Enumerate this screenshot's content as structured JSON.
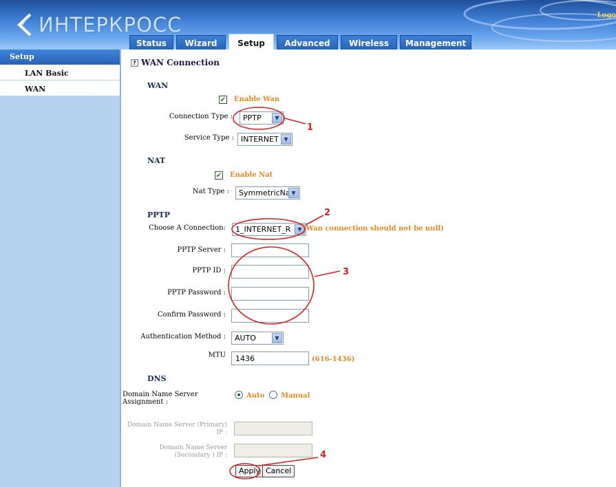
{
  "header": {
    "logo_text": "ИНТЕРКРОСС",
    "logout_label": "Logo"
  },
  "tabs": [
    {
      "label": "Status"
    },
    {
      "label": "Wizard"
    },
    {
      "label": "Setup",
      "active": true
    },
    {
      "label": "Advanced"
    },
    {
      "label": "Wireless"
    },
    {
      "label": "Management"
    }
  ],
  "sidebar": {
    "heading": "Setup",
    "items": [
      {
        "label": "LAN Basic"
      },
      {
        "label": "WAN"
      }
    ]
  },
  "page": {
    "help_icon_glyph": "?",
    "title": "WAN Connection"
  },
  "wan": {
    "section": "WAN",
    "enable_label": "Enable Wan",
    "enable_checked": true,
    "connection_type_label": "Connection Type :",
    "connection_type_value": "PPTP",
    "service_type_label": "Service Type :",
    "service_type_value": "INTERNET"
  },
  "nat": {
    "section": "NAT",
    "enable_label": "Enable Nat",
    "enable_checked": true,
    "type_label": "Nat Type :",
    "type_value": "SymmetricNat"
  },
  "pptp": {
    "section": "PPTP",
    "choose_label": "Choose A Connection:",
    "choose_value": "1_INTERNET_R",
    "choose_hint": "(Wan connection should not be null)",
    "server_label": "PPTP Server :",
    "server_value": "",
    "id_label": "PPTP ID :",
    "id_value": "",
    "password_label": "PPTP Password :",
    "password_value": "",
    "confirm_label": "Confirm Password :",
    "confirm_value": "",
    "auth_label": "Authentication Method :",
    "auth_value": "AUTO",
    "mtu_label": "MTU",
    "mtu_value": "1436",
    "mtu_range": "(616-1436)"
  },
  "dns": {
    "section": "DNS",
    "assignment_label": "Domain Name Server Assignment :",
    "auto_label": "Auto",
    "manual_label": "Manual",
    "selected": "Auto",
    "primary_label": "Domain Name Server (Primary) IP :",
    "secondary_label": "Domain Name Server (Secondary ) IP :"
  },
  "actions": {
    "apply_label": "Apply",
    "cancel_label": "Cancel"
  },
  "annotations": {
    "one": "1",
    "two": "2",
    "three": "3",
    "four": "4",
    "color": "#d8201e"
  },
  "colors": {
    "header_blue": "#3f7fd4",
    "sidebar_bg": "#b6d2ee",
    "accent_orange": "#e08a1e",
    "logout_yellow": "#f2d64b"
  }
}
